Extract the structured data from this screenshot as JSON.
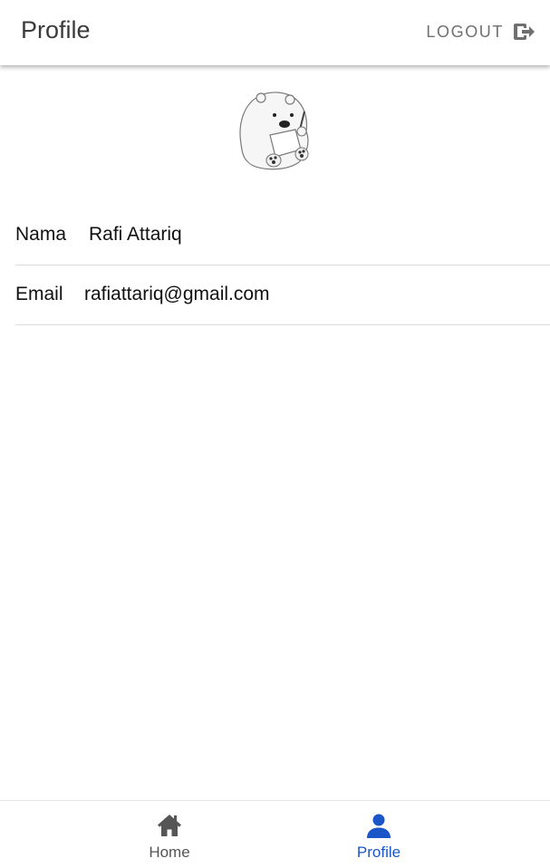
{
  "header": {
    "title": "Profile",
    "logout_label": "LOGOUT",
    "logout_icon": "logout-icon"
  },
  "profile": {
    "avatar_icon": "bear-drawing-avatar",
    "fields": [
      {
        "label": "Nama",
        "value": "Rafi Attariq"
      },
      {
        "label": "Email",
        "value": "rafiattariq@gmail.com"
      }
    ]
  },
  "bottom_nav": {
    "items": [
      {
        "label": "Home",
        "icon": "home-icon",
        "active": false
      },
      {
        "label": "Profile",
        "icon": "person-icon",
        "active": true
      }
    ]
  },
  "colors": {
    "accent": "#1a56c7",
    "inactive": "#555555",
    "title_text": "#3b3b3b",
    "divider": "#dcdcdc"
  }
}
